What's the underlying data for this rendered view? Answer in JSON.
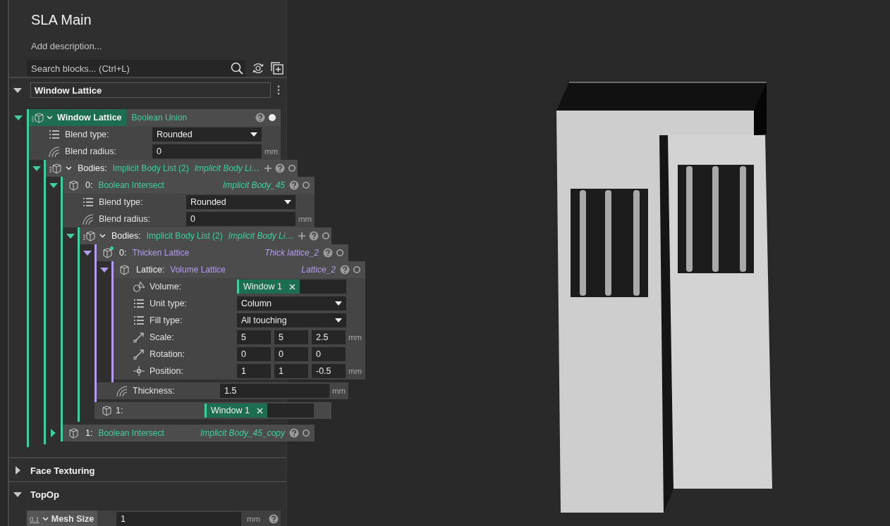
{
  "title": "SLA Main",
  "description": {
    "placeholder": "Add description..."
  },
  "search": {
    "placeholder": "Search blocks... (Ctrl+L)"
  },
  "sections": [
    {
      "title": "Window Lattice",
      "selected": true,
      "expanded": true,
      "kind": "blocks",
      "block": {
        "kind": "root",
        "label": "Window Lattice",
        "type": "Boolean Union",
        "color": "#3ecf9a",
        "expanded": true,
        "visible": true,
        "rows": [
          {
            "kind": "dropdown",
            "label": "Blend type:",
            "value": "Rounded"
          },
          {
            "kind": "number",
            "label": "Blend radius:",
            "value": "0",
            "unit": "mm"
          },
          {
            "kind": "list",
            "label": "Bodies:",
            "type": "Implicit Body List (2)",
            "name": "Implicit Body Li…",
            "color": "#3ecf9a",
            "expanded": true,
            "visible": false,
            "rows": [
              {
                "kind": "item",
                "index": "0:",
                "type": "Boolean Intersect",
                "name": "Implicit Body_45",
                "color": "#3ecf9a",
                "expanded": true,
                "visible": false,
                "modified": false,
                "rows": [
                  {
                    "kind": "dropdown",
                    "label": "Blend type:",
                    "value": "Rounded"
                  },
                  {
                    "kind": "number",
                    "label": "Blend radius:",
                    "value": "0",
                    "unit": "mm"
                  },
                  {
                    "kind": "list",
                    "label": "Bodies:",
                    "type": "Implicit Body List (2)",
                    "name": "Implicit Body Li…",
                    "color": "#3ecf9a",
                    "expanded": true,
                    "visible": false,
                    "rows": [
                      {
                        "kind": "item",
                        "index": "0:",
                        "type": "Thicken Lattice",
                        "name": "Thick lattice_2",
                        "color": "#b59cf0",
                        "expanded": true,
                        "visible": false,
                        "modified": true,
                        "rows": [
                          {
                            "kind": "item",
                            "index": "Lattice:",
                            "type": "Volume Lattice",
                            "name": "Lattice_2",
                            "color": "#b59cf0",
                            "expanded": true,
                            "visible": false,
                            "modified": false,
                            "rows": [
                              {
                                "kind": "chip",
                                "label": "Volume:",
                                "value": "Window 1"
                              },
                              {
                                "kind": "dropdown",
                                "label": "Unit type:",
                                "value": "Column"
                              },
                              {
                                "kind": "dropdown",
                                "label": "Fill type:",
                                "value": "All touching"
                              },
                              {
                                "kind": "vector",
                                "label": "Scale:",
                                "values": [
                                  "5",
                                  "5",
                                  "2.5"
                                ],
                                "unit": "mm"
                              },
                              {
                                "kind": "vector",
                                "label": "Rotation:",
                                "values": [
                                  "0",
                                  "0",
                                  "0"
                                ]
                              },
                              {
                                "kind": "point",
                                "label": "Position:",
                                "values": [
                                  "1",
                                  "1",
                                  "-0.5"
                                ],
                                "unit": "mm"
                              }
                            ]
                          },
                          {
                            "kind": "number",
                            "label": "Thickness:",
                            "value": "1.5",
                            "unit": "mm"
                          }
                        ]
                      },
                      {
                        "kind": "ref",
                        "index": "1:",
                        "value": "Window 1"
                      }
                    ]
                  }
                ]
              },
              {
                "kind": "item",
                "index": "1:",
                "type": "Boolean Intersect",
                "name": "Implicit Body_45_copy",
                "color": "#3ecf9a",
                "expanded": false,
                "visible": false,
                "modified": false
              }
            ]
          }
        ]
      }
    },
    {
      "title": "Face Texturing",
      "selected": false,
      "expanded": false
    },
    {
      "title": "TopOp",
      "selected": false,
      "expanded": true,
      "kind": "settings",
      "rows": [
        {
          "badge": "0.1",
          "label": "Mesh Size",
          "value": "1",
          "unit": "mm"
        }
      ]
    }
  ]
}
